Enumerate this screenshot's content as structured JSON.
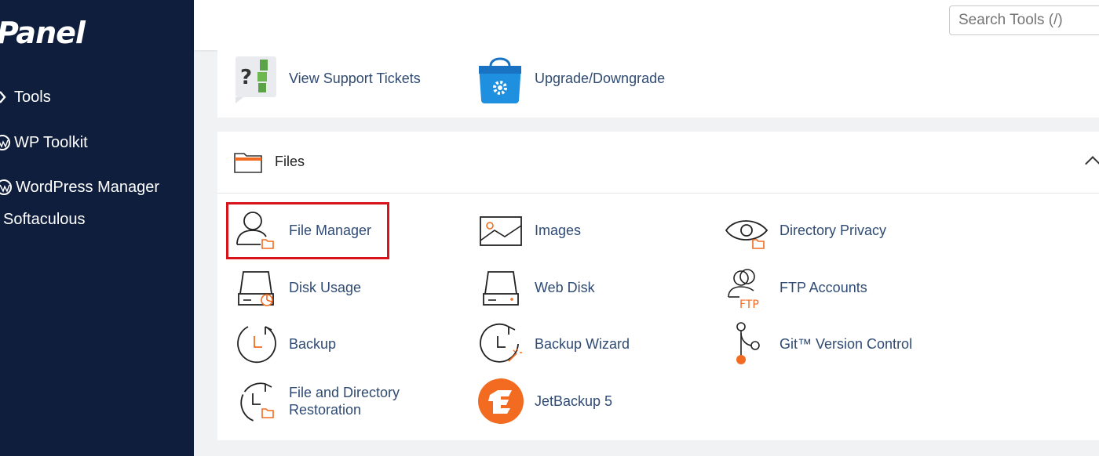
{
  "sidebar": {
    "logo_text": "Panel",
    "items": [
      {
        "label": "Tools",
        "icon": "tools-icon"
      },
      {
        "label": "WP Toolkit",
        "icon": "wordpress-icon"
      },
      {
        "label": "WordPress Manager",
        "icon": "wordpress-icon"
      },
      {
        "label": "Softaculous",
        "icon": "softaculous-icon"
      }
    ]
  },
  "header": {
    "search_placeholder": "Search Tools (/)"
  },
  "top_section": {
    "items": [
      {
        "label": "View Support Tickets",
        "icon": "support-tickets-icon"
      },
      {
        "label": "Upgrade/Downgrade",
        "icon": "shopping-bag-gear-icon"
      }
    ]
  },
  "files_section": {
    "title": "Files",
    "icon": "folder-icon",
    "collapse_icon": "chevron-up-icon",
    "items": [
      {
        "label": "File Manager",
        "icon": "file-manager-icon",
        "highlighted": true
      },
      {
        "label": "Images",
        "icon": "image-icon"
      },
      {
        "label": "Directory Privacy",
        "icon": "eye-folder-icon"
      },
      {
        "label": "Disk Usage",
        "icon": "disk-usage-icon"
      },
      {
        "label": "Web Disk",
        "icon": "disk-icon"
      },
      {
        "label": "FTP Accounts",
        "icon": "ftp-users-icon"
      },
      {
        "label": "Backup",
        "icon": "backup-clock-icon"
      },
      {
        "label": "Backup Wizard",
        "icon": "backup-wizard-icon"
      },
      {
        "label": "Git™ Version Control",
        "icon": "git-branch-icon"
      },
      {
        "label_line1": "File and Directory",
        "label_line2": "Restoration",
        "icon": "restore-folder-icon"
      },
      {
        "label": "JetBackup 5",
        "icon": "jetbackup-logo-icon"
      }
    ]
  },
  "colors": {
    "sidebar_bg": "#0f1e3d",
    "link_text": "#2f4a73",
    "accent_orange": "#f26b21",
    "highlight_red": "#d9131a"
  }
}
